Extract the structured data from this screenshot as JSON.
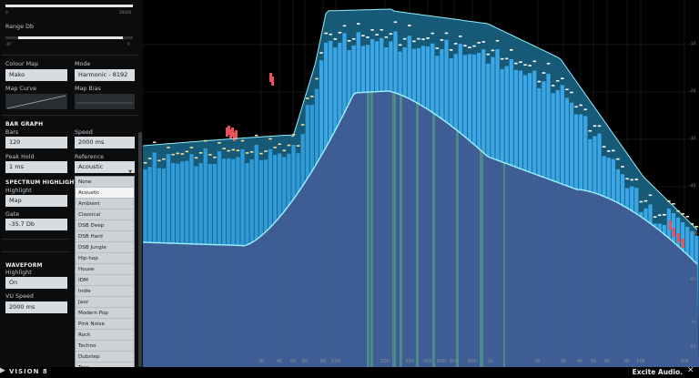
{
  "panel": {
    "range_sliders": {
      "freq_min": "0",
      "freq_max": "20000",
      "range_label": "Range Db",
      "db_min": "-97",
      "db_max": "0"
    },
    "colour_map": {
      "label": "Colour Map",
      "value": "Mako"
    },
    "mode": {
      "label": "Mode",
      "value": "Harmonic - 8192"
    },
    "map_curve_label": "Map Curve",
    "map_bias_label": "Map Bias",
    "bar_graph": {
      "header": "BAR GRAPH",
      "bars_label": "Bars",
      "bars_value": "120",
      "speed_label": "Speed",
      "speed_value": "2000 ms",
      "peak_hold_label": "Peak Hold",
      "peak_hold_value": "1 ms",
      "reference_label": "Reference",
      "reference_value": "Acoustic"
    },
    "spectrum_highlight": {
      "header": "SPECTRUM HIGHLIGHT",
      "highlight_label": "Highlight",
      "highlight_value": "Map",
      "gate_label": "Gate",
      "gate_value": "-35.7 Db"
    },
    "waveform": {
      "header": "WAVEFORM",
      "highlight_label": "Highlight",
      "highlight_value": "On",
      "vu_speed_label": "VU Speed",
      "vu_speed_value": "2000 ms"
    },
    "reference_options": [
      "None",
      "Acoustic",
      "Ambient",
      "Classical",
      "DSB Deep",
      "DSB Hard",
      "DSB Jungle",
      "Hip-hop",
      "House",
      "IDM",
      "Indie",
      "Jazz",
      "Modern Pop",
      "Pink Noise",
      "Rock",
      "Techno",
      "Dubstep",
      "Trap"
    ],
    "reference_selected_index": 1
  },
  "spectrum": {
    "freq_labels": [
      "30",
      "40",
      "50",
      "60",
      "80",
      "100",
      "200",
      "300",
      "400",
      "500",
      "600",
      "800",
      "1k",
      "2k",
      "3k",
      "4k",
      "5k",
      "6k",
      "8k",
      "10k",
      "20k"
    ],
    "db_labels": [
      "-10",
      "-20",
      "-30",
      "-40",
      "-50",
      "-60",
      "-70",
      "-80",
      "-90"
    ],
    "colors": {
      "background": "#000000",
      "grid": "#25292d",
      "bars": "#3aa6e6",
      "bars_dim": "#1d6f9e",
      "reference_fill": "#3f5b92",
      "reference_line": "#9cf3ff",
      "envelope_fill": "#175a78",
      "envelope_line": "#8ff0ff",
      "peak_marks": "#ffffff",
      "peak_marks_low": "#f1e39a",
      "over_reference": "#e8525a"
    }
  },
  "footer": {
    "logo": "VISION 8",
    "brand": "Excite Audio."
  },
  "icons": [
    "play-icon",
    "wave-icon",
    "expand-icon"
  ]
}
